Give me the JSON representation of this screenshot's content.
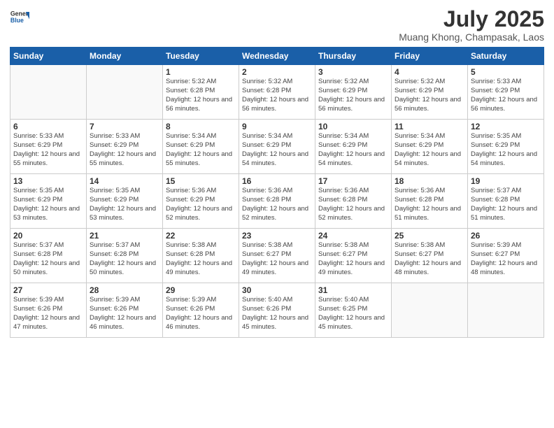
{
  "header": {
    "logo_line1": "General",
    "logo_line2": "Blue",
    "title": "July 2025",
    "subtitle": "Muang Khong, Champasak, Laos"
  },
  "weekdays": [
    "Sunday",
    "Monday",
    "Tuesday",
    "Wednesday",
    "Thursday",
    "Friday",
    "Saturday"
  ],
  "weeks": [
    [
      {
        "day": "",
        "info": ""
      },
      {
        "day": "",
        "info": ""
      },
      {
        "day": "1",
        "info": "Sunrise: 5:32 AM\nSunset: 6:28 PM\nDaylight: 12 hours and 56 minutes."
      },
      {
        "day": "2",
        "info": "Sunrise: 5:32 AM\nSunset: 6:28 PM\nDaylight: 12 hours and 56 minutes."
      },
      {
        "day": "3",
        "info": "Sunrise: 5:32 AM\nSunset: 6:29 PM\nDaylight: 12 hours and 56 minutes."
      },
      {
        "day": "4",
        "info": "Sunrise: 5:32 AM\nSunset: 6:29 PM\nDaylight: 12 hours and 56 minutes."
      },
      {
        "day": "5",
        "info": "Sunrise: 5:33 AM\nSunset: 6:29 PM\nDaylight: 12 hours and 56 minutes."
      }
    ],
    [
      {
        "day": "6",
        "info": "Sunrise: 5:33 AM\nSunset: 6:29 PM\nDaylight: 12 hours and 55 minutes."
      },
      {
        "day": "7",
        "info": "Sunrise: 5:33 AM\nSunset: 6:29 PM\nDaylight: 12 hours and 55 minutes."
      },
      {
        "day": "8",
        "info": "Sunrise: 5:34 AM\nSunset: 6:29 PM\nDaylight: 12 hours and 55 minutes."
      },
      {
        "day": "9",
        "info": "Sunrise: 5:34 AM\nSunset: 6:29 PM\nDaylight: 12 hours and 54 minutes."
      },
      {
        "day": "10",
        "info": "Sunrise: 5:34 AM\nSunset: 6:29 PM\nDaylight: 12 hours and 54 minutes."
      },
      {
        "day": "11",
        "info": "Sunrise: 5:34 AM\nSunset: 6:29 PM\nDaylight: 12 hours and 54 minutes."
      },
      {
        "day": "12",
        "info": "Sunrise: 5:35 AM\nSunset: 6:29 PM\nDaylight: 12 hours and 54 minutes."
      }
    ],
    [
      {
        "day": "13",
        "info": "Sunrise: 5:35 AM\nSunset: 6:29 PM\nDaylight: 12 hours and 53 minutes."
      },
      {
        "day": "14",
        "info": "Sunrise: 5:35 AM\nSunset: 6:29 PM\nDaylight: 12 hours and 53 minutes."
      },
      {
        "day": "15",
        "info": "Sunrise: 5:36 AM\nSunset: 6:29 PM\nDaylight: 12 hours and 52 minutes."
      },
      {
        "day": "16",
        "info": "Sunrise: 5:36 AM\nSunset: 6:28 PM\nDaylight: 12 hours and 52 minutes."
      },
      {
        "day": "17",
        "info": "Sunrise: 5:36 AM\nSunset: 6:28 PM\nDaylight: 12 hours and 52 minutes."
      },
      {
        "day": "18",
        "info": "Sunrise: 5:36 AM\nSunset: 6:28 PM\nDaylight: 12 hours and 51 minutes."
      },
      {
        "day": "19",
        "info": "Sunrise: 5:37 AM\nSunset: 6:28 PM\nDaylight: 12 hours and 51 minutes."
      }
    ],
    [
      {
        "day": "20",
        "info": "Sunrise: 5:37 AM\nSunset: 6:28 PM\nDaylight: 12 hours and 50 minutes."
      },
      {
        "day": "21",
        "info": "Sunrise: 5:37 AM\nSunset: 6:28 PM\nDaylight: 12 hours and 50 minutes."
      },
      {
        "day": "22",
        "info": "Sunrise: 5:38 AM\nSunset: 6:28 PM\nDaylight: 12 hours and 49 minutes."
      },
      {
        "day": "23",
        "info": "Sunrise: 5:38 AM\nSunset: 6:27 PM\nDaylight: 12 hours and 49 minutes."
      },
      {
        "day": "24",
        "info": "Sunrise: 5:38 AM\nSunset: 6:27 PM\nDaylight: 12 hours and 49 minutes."
      },
      {
        "day": "25",
        "info": "Sunrise: 5:38 AM\nSunset: 6:27 PM\nDaylight: 12 hours and 48 minutes."
      },
      {
        "day": "26",
        "info": "Sunrise: 5:39 AM\nSunset: 6:27 PM\nDaylight: 12 hours and 48 minutes."
      }
    ],
    [
      {
        "day": "27",
        "info": "Sunrise: 5:39 AM\nSunset: 6:26 PM\nDaylight: 12 hours and 47 minutes."
      },
      {
        "day": "28",
        "info": "Sunrise: 5:39 AM\nSunset: 6:26 PM\nDaylight: 12 hours and 46 minutes."
      },
      {
        "day": "29",
        "info": "Sunrise: 5:39 AM\nSunset: 6:26 PM\nDaylight: 12 hours and 46 minutes."
      },
      {
        "day": "30",
        "info": "Sunrise: 5:40 AM\nSunset: 6:26 PM\nDaylight: 12 hours and 45 minutes."
      },
      {
        "day": "31",
        "info": "Sunrise: 5:40 AM\nSunset: 6:25 PM\nDaylight: 12 hours and 45 minutes."
      },
      {
        "day": "",
        "info": ""
      },
      {
        "day": "",
        "info": ""
      }
    ]
  ]
}
